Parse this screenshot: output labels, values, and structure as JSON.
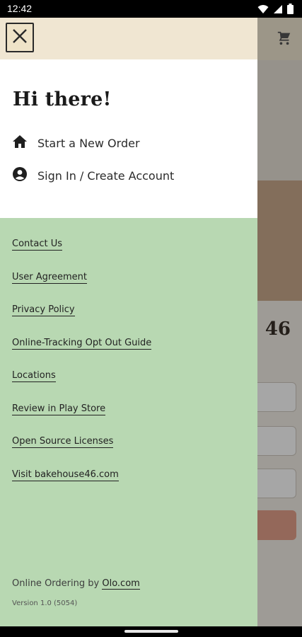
{
  "status_bar": {
    "time": "12:42"
  },
  "background": {
    "store_number": "46"
  },
  "drawer": {
    "greeting": "Hi there!",
    "primary_items": [
      {
        "label": "Start a New Order",
        "icon": "home-icon"
      },
      {
        "label": "Sign In / Create Account",
        "icon": "account-icon"
      }
    ],
    "links": [
      "Contact Us",
      "User Agreement",
      "Privacy Policy",
      "Online-Tracking Opt Out Guide",
      "Locations",
      "Review in Play Store",
      "Open Source Licenses",
      "Visit bakehouse46.com"
    ],
    "footer": {
      "ordering_prefix": "Online Ordering by",
      "ordering_link": "Olo.com",
      "version": "Version 1.0 (5054)"
    }
  },
  "colors": {
    "drawer_header": "#f0e6d2",
    "drawer_links_bg": "#b8d8b2",
    "accent_button": "#e4a08a"
  }
}
